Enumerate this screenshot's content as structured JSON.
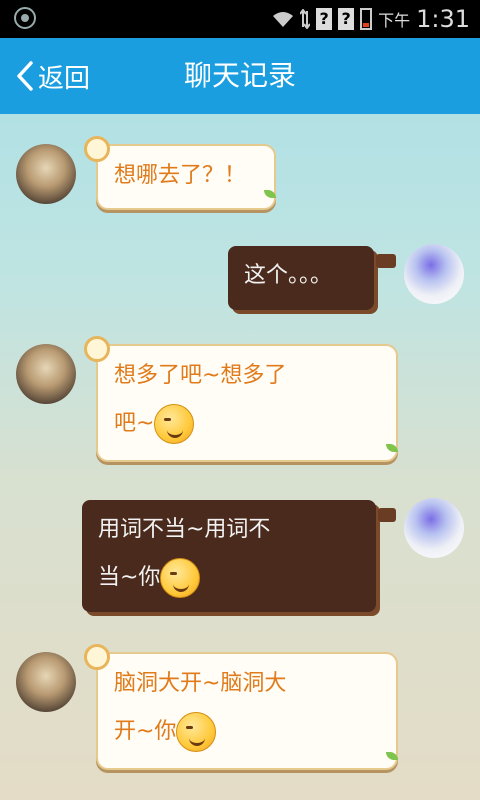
{
  "status_bar": {
    "time": "1:31",
    "ampm": "下午",
    "sim1": "?",
    "sim2": "?",
    "icons": [
      "settings-circle-icon",
      "wifi-icon",
      "data-arrows-icon",
      "battery-low-icon"
    ]
  },
  "header": {
    "back_label": "返回",
    "title": "聊天记录",
    "bg_color": "#1a9ee0"
  },
  "messages": [
    {
      "side": "left",
      "lines": [
        "想哪去了？！"
      ],
      "emoji": false
    },
    {
      "side": "right",
      "lines": [
        "这个。。。"
      ],
      "emoji": false
    },
    {
      "side": "left",
      "lines": [
        "想多了吧~想多了",
        "吧~"
      ],
      "emoji": "smirk-emoji"
    },
    {
      "side": "right",
      "lines": [
        "用词不当~用词不",
        "当~你"
      ],
      "emoji": "wink-emoji"
    },
    {
      "side": "left",
      "lines": [
        "脑洞大开~脑洞大",
        "开~你"
      ],
      "emoji": "smirk-emoji"
    }
  ],
  "colors": {
    "incoming_text": "#e07a1a",
    "outgoing_bg": "#4a2a1d",
    "outgoing_text": "#f2f2f2"
  }
}
